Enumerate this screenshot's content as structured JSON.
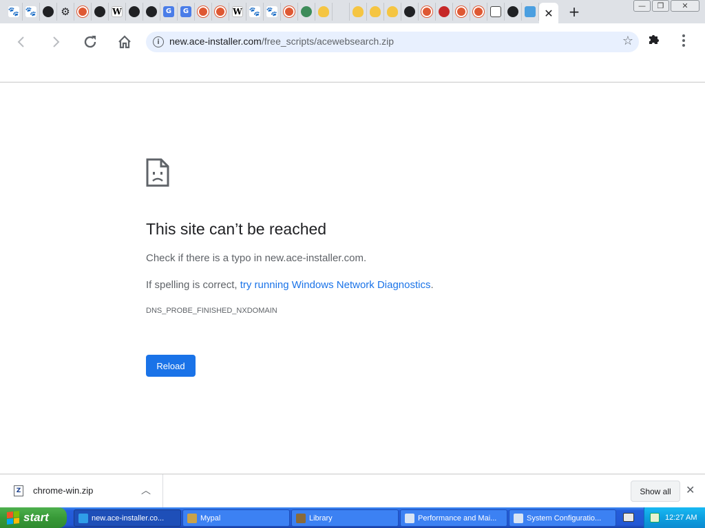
{
  "tabs": [
    {
      "icon": "paw-icon",
      "glyph": "🐾",
      "cls": "paw"
    },
    {
      "icon": "paw-icon",
      "glyph": "🐾",
      "cls": "paw"
    },
    {
      "icon": "globe-icon",
      "glyph": "",
      "cls": "globe"
    },
    {
      "icon": "gear-icon",
      "glyph": "⚙",
      "cls": "gear"
    },
    {
      "icon": "duckduckgo-icon",
      "glyph": "",
      "cls": "ddg"
    },
    {
      "icon": "globe-icon",
      "glyph": "",
      "cls": "globe"
    },
    {
      "icon": "wikipedia-icon",
      "glyph": "W",
      "cls": "wiki"
    },
    {
      "icon": "globe-icon",
      "glyph": "",
      "cls": "globe"
    },
    {
      "icon": "globe-icon",
      "glyph": "",
      "cls": "globe"
    },
    {
      "icon": "translate-icon",
      "glyph": "G",
      "cls": "trans"
    },
    {
      "icon": "translate-icon",
      "glyph": "G",
      "cls": "trans"
    },
    {
      "icon": "duckduckgo-icon",
      "glyph": "",
      "cls": "ddg"
    },
    {
      "icon": "duckduckgo-icon",
      "glyph": "",
      "cls": "ddg"
    },
    {
      "icon": "wikipedia-icon",
      "glyph": "W",
      "cls": "wiki"
    },
    {
      "icon": "paw-icon",
      "glyph": "🐾",
      "cls": "paw"
    },
    {
      "icon": "paw-icon",
      "glyph": "🐾",
      "cls": "paw"
    },
    {
      "icon": "duckduckgo-icon",
      "glyph": "",
      "cls": "ddg"
    },
    {
      "icon": "earth-icon",
      "glyph": "",
      "cls": "earth"
    },
    {
      "icon": "cup-icon",
      "glyph": "",
      "cls": "cup"
    },
    {
      "icon": "blank-icon",
      "glyph": "",
      "cls": "blank"
    },
    {
      "icon": "cup-icon",
      "glyph": "",
      "cls": "cup"
    },
    {
      "icon": "cup-icon",
      "glyph": "",
      "cls": "cup"
    },
    {
      "icon": "cup-icon",
      "glyph": "",
      "cls": "cup"
    },
    {
      "icon": "globe-icon",
      "glyph": "",
      "cls": "globe"
    },
    {
      "icon": "duckduckgo-icon",
      "glyph": "",
      "cls": "ddg"
    },
    {
      "icon": "power-icon",
      "glyph": "",
      "cls": "red"
    },
    {
      "icon": "duckduckgo-icon",
      "glyph": "",
      "cls": "ddg"
    },
    {
      "icon": "duckduckgo-icon",
      "glyph": "",
      "cls": "ddg"
    },
    {
      "icon": "grid-icon",
      "glyph": "",
      "cls": "grid"
    },
    {
      "icon": "globe-icon",
      "glyph": "",
      "cls": "globe"
    },
    {
      "icon": "weather-icon",
      "glyph": "",
      "cls": "weather"
    }
  ],
  "active_tab": {
    "icon": "close-icon",
    "glyph": "✕"
  },
  "new_tab": "+",
  "window_buttons": {
    "minimize": "—",
    "restore": "❐",
    "close": "✕"
  },
  "omnibox": {
    "host": "new.ace-installer.com",
    "path": "/free_scripts/acewebsearch.zip"
  },
  "error": {
    "title": "This site can’t be reached",
    "line1": "Check if there is a typo in new.ace-installer.com.",
    "line2_prefix": "If spelling is correct, ",
    "line2_link": "try running Windows Network Diagnostics",
    "line2_suffix": ".",
    "code": "DNS_PROBE_FINISHED_NXDOMAIN",
    "reload": "Reload"
  },
  "download": {
    "filename": "chrome-win.zip",
    "show_all": "Show all"
  },
  "taskbar": {
    "start": "start",
    "tasks": [
      {
        "label": "new.ace-installer.co...",
        "color": "#2f9de8"
      },
      {
        "label": "Mypal",
        "color": "#c9a24a"
      },
      {
        "label": "Library",
        "color": "#8a6a3a"
      },
      {
        "label": "Performance and Mai...",
        "color": "#d8e4f4"
      },
      {
        "label": "System Configuratio...",
        "color": "#d8e4f4"
      }
    ],
    "clock": "12:27 AM"
  },
  "colors": {
    "accent": "#1a73e8",
    "tabstrip": "#dee1e6",
    "omnibox": "#e8f0fe"
  }
}
